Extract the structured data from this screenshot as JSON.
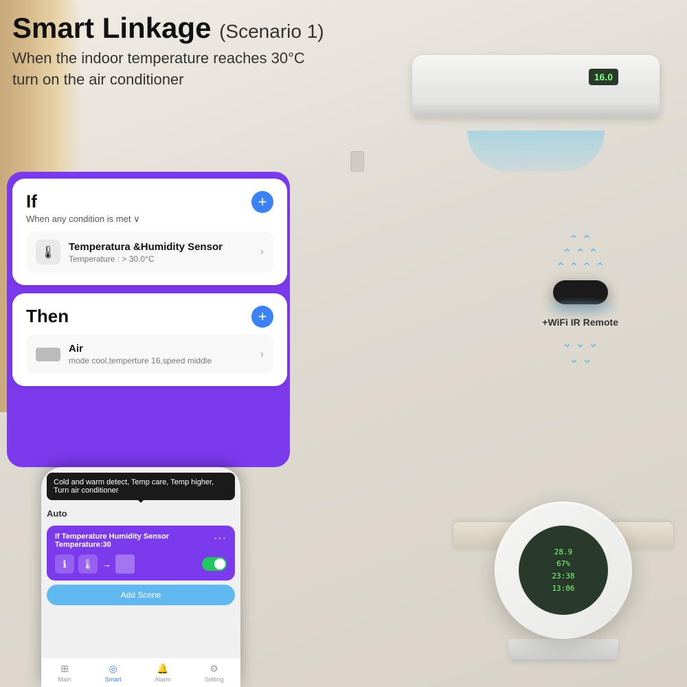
{
  "header": {
    "title": "Smart Linkage",
    "scenario": "(Scenario 1)",
    "subtitle_line1": "When the indoor temperature reaches 30°C",
    "subtitle_line2": "turn on the air conditioner"
  },
  "if_card": {
    "title": "If",
    "subtitle": "When any condition is met",
    "subtitle_arrow": "∨",
    "add_btn": "+",
    "sensor": {
      "name": "Temperatura &Humidity Sensor",
      "detail": "Temperature : > 30.0°C"
    }
  },
  "then_card": {
    "title": "Then",
    "add_btn": "+",
    "device": {
      "name": "Air",
      "detail": "mode cool,temperture 16,speed middle"
    }
  },
  "phone": {
    "tooltip": "Cold and warm detect, Temp care, Temp higher, Turn air conditioner",
    "section_label": "Auto",
    "automation_title": "If Temperature Humidity Sensor Temperature:30",
    "add_scene_label": "Add Scene"
  },
  "ir_remote": {
    "label": "+WiFi IR Remote"
  },
  "nav": {
    "items": [
      {
        "label": "Main",
        "icon": "⊞",
        "active": false
      },
      {
        "label": "Smart",
        "icon": "◎",
        "active": true
      },
      {
        "label": "Alarm",
        "icon": "🔔",
        "active": false
      },
      {
        "label": "Setting",
        "icon": "⚙",
        "active": false
      }
    ]
  },
  "ac_display": "16.0",
  "thermostat_display": [
    "28.9",
    "67%",
    "23:38",
    "13:06"
  ]
}
